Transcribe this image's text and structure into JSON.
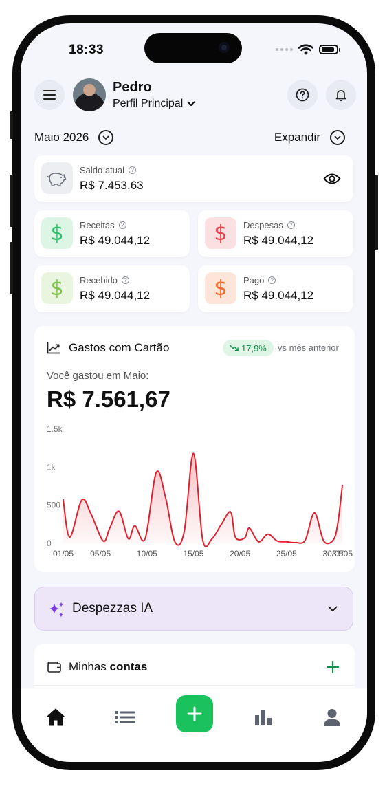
{
  "status_bar": {
    "time": "18:33"
  },
  "header": {
    "user_name": "Pedro",
    "profile_label": "Perfil Principal"
  },
  "period": {
    "month_label": "Maio 2026",
    "expand_label": "Expandir"
  },
  "balance": {
    "label": "Saldo atual",
    "value": "R$ 7.453,63"
  },
  "stats": [
    {
      "label": "Receitas",
      "value": "R$ 49.044,12",
      "color": "#2fbf6a"
    },
    {
      "label": "Despesas",
      "value": "R$ 49.044,12",
      "color": "#e0424a"
    },
    {
      "label": "Recebido",
      "value": "R$ 49.044,12",
      "color": "#7cc24a"
    },
    {
      "label": "Pago",
      "value": "R$ 49.044,12",
      "color": "#ef6a2e"
    }
  ],
  "card_spending": {
    "title": "Gastos com Cartão",
    "change_badge": "17,9%",
    "comparison_label": "vs mês anterior",
    "spent_label": "Você gastou em Maio:",
    "spent_value": "R$ 7.561,67"
  },
  "chart_data": {
    "type": "area",
    "title": "",
    "xlabel": "",
    "ylabel": "",
    "ylim": [
      0,
      1500
    ],
    "y_ticks": [
      "0",
      "500",
      "1k",
      "1.5k"
    ],
    "x_ticks": [
      "01/05",
      "05/05",
      "10/05",
      "15/05",
      "20/05",
      "25/05",
      "30/05",
      "31/05"
    ],
    "series": [
      {
        "color": "#e0202e",
        "x": [
          1,
          1.7,
          3,
          4,
          5.3,
          6,
          7,
          8,
          8.7,
          9.8,
          11,
          12,
          13,
          14,
          15,
          16,
          17,
          18,
          19,
          19.5,
          20.5,
          21,
          22,
          23,
          24,
          25,
          26,
          27,
          28,
          29,
          30,
          30.5,
          31
        ],
        "y": [
          570,
          80,
          570,
          380,
          30,
          200,
          420,
          60,
          230,
          60,
          930,
          600,
          20,
          150,
          1180,
          40,
          60,
          250,
          410,
          80,
          70,
          200,
          20,
          120,
          30,
          20,
          10,
          40,
          400,
          30,
          40,
          250,
          760
        ]
      }
    ]
  },
  "ai_section": {
    "title": "Despezzas IA"
  },
  "accounts": {
    "title_prefix": "Minhas ",
    "title_bold": "contas"
  },
  "tabbar": {
    "items": [
      "home-icon",
      "list-icon",
      "add-icon",
      "chart-icon",
      "profile-icon"
    ],
    "accent": "#19c25c"
  }
}
